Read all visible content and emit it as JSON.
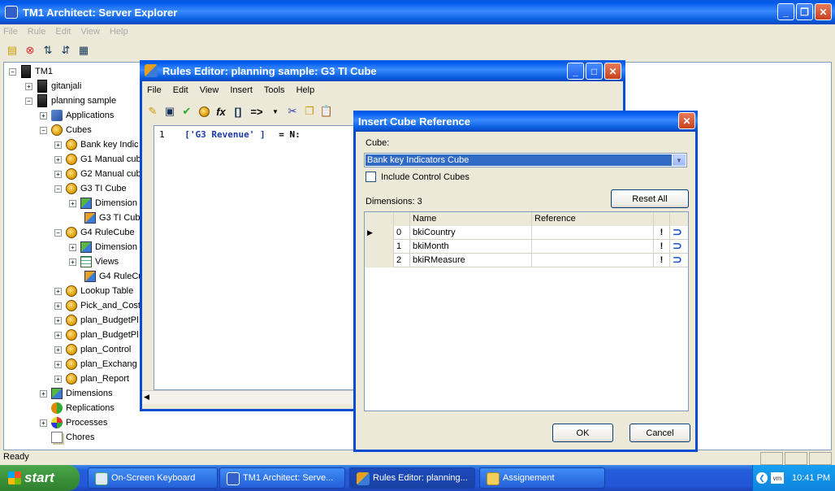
{
  "main_window": {
    "title": "TM1 Architect: Server Explorer",
    "menu": [
      "File",
      "Rule",
      "Edit",
      "View",
      "Help"
    ],
    "tree": [
      {
        "label": "TM1",
        "indent": 0,
        "icon": "server-icon"
      },
      {
        "label": "gitanjali",
        "indent": 1,
        "icon": "server-icon"
      },
      {
        "label": "planning sample",
        "indent": 1,
        "icon": "server-icon"
      },
      {
        "label": "Applications",
        "indent": 2,
        "icon": "applications-icon"
      },
      {
        "label": "Cubes",
        "indent": 2,
        "icon": "cube-icon"
      },
      {
        "label": "Bank key Indic",
        "indent": 3,
        "icon": "cube-icon"
      },
      {
        "label": "G1 Manual cub",
        "indent": 3,
        "icon": "cube-icon"
      },
      {
        "label": "G2 Manual cub",
        "indent": 3,
        "icon": "cube-icon"
      },
      {
        "label": "G3 TI Cube",
        "indent": 3,
        "icon": "cube-icon"
      },
      {
        "label": "Dimension",
        "indent": 4,
        "icon": "dimension-icon"
      },
      {
        "label": "G3 TI Cub",
        "indent": 4,
        "icon": "rule-icon"
      },
      {
        "label": "G4 RuleCube",
        "indent": 3,
        "icon": "cube-icon"
      },
      {
        "label": "Dimension",
        "indent": 4,
        "icon": "dimension-icon"
      },
      {
        "label": "Views",
        "indent": 4,
        "icon": "view-icon"
      },
      {
        "label": "G4 RuleCu",
        "indent": 4,
        "icon": "rule-icon"
      },
      {
        "label": "Lookup Table",
        "indent": 3,
        "icon": "cube-icon"
      },
      {
        "label": "Pick_and_Cost",
        "indent": 3,
        "icon": "cube-icon"
      },
      {
        "label": "plan_BudgetPl",
        "indent": 3,
        "icon": "cube-icon"
      },
      {
        "label": "plan_BudgetPl",
        "indent": 3,
        "icon": "cube-icon"
      },
      {
        "label": "plan_Control",
        "indent": 3,
        "icon": "cube-icon"
      },
      {
        "label": "plan_Exchang",
        "indent": 3,
        "icon": "cube-icon"
      },
      {
        "label": "plan_Report",
        "indent": 3,
        "icon": "cube-icon"
      },
      {
        "label": "Dimensions",
        "indent": 2,
        "icon": "dimension-icon"
      },
      {
        "label": "Replications",
        "indent": 2,
        "icon": "replication-icon"
      },
      {
        "label": "Processes",
        "indent": 2,
        "icon": "process-icon"
      },
      {
        "label": "Chores",
        "indent": 2,
        "icon": "chore-icon"
      }
    ],
    "status": "Ready"
  },
  "rules_editor": {
    "title": "Rules Editor: planning sample: G3 TI Cube",
    "menu": [
      "File",
      "Edit",
      "View",
      "Insert",
      "Tools",
      "Help"
    ],
    "toolbar_text": [
      "[]",
      "=>"
    ],
    "line_number": "1",
    "code_string": "['G3 Revenue' ]",
    "code_tail": "= N:"
  },
  "insert_cube_reference": {
    "title": "Insert Cube Reference",
    "cube_label": "Cube:",
    "cube_value": "Bank key Indicators Cube",
    "include_control_label": "Include Control Cubes",
    "include_control_checked": false,
    "dimensions_label": "Dimensions: 3",
    "reset_all_label": "Reset All",
    "columns": [
      "Name",
      "Reference"
    ],
    "rows": [
      {
        "index": "0",
        "name": "bkiCountry",
        "reference": "",
        "flag": "!",
        "selected": true
      },
      {
        "index": "1",
        "name": "bkiMonth",
        "reference": "",
        "flag": "!",
        "selected": false
      },
      {
        "index": "2",
        "name": "bkiRMeasure",
        "reference": "",
        "flag": "!",
        "selected": false
      }
    ],
    "ok_label": "OK",
    "cancel_label": "Cancel"
  },
  "taskbar": {
    "start_label": "start",
    "items": [
      {
        "label": "On-Screen Keyboard",
        "active": false
      },
      {
        "label": "TM1 Architect: Serve...",
        "active": false
      },
      {
        "label": "Rules Editor: planning...",
        "active": true
      },
      {
        "label": "Assignement",
        "active": false
      }
    ],
    "clock": "10:41 PM"
  }
}
